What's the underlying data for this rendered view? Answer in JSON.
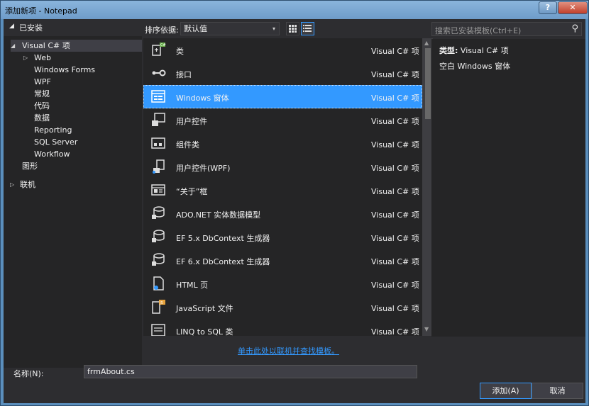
{
  "window": {
    "title": "添加新项 - Notepad",
    "help": "?",
    "close": "✕"
  },
  "left": {
    "header": "已安装",
    "tree": [
      {
        "label": "Visual C# 项",
        "selected": true
      },
      {
        "label": "Web"
      },
      {
        "label": "Windows Forms"
      },
      {
        "label": "WPF"
      },
      {
        "label": "常规"
      },
      {
        "label": "代码"
      },
      {
        "label": "数据"
      },
      {
        "label": "Reporting"
      },
      {
        "label": "SQL Server"
      },
      {
        "label": "Workflow"
      },
      {
        "label": "图形"
      },
      {
        "label": "联机"
      }
    ]
  },
  "toolbar": {
    "sort_label": "排序依据:",
    "sort_value": "默认值"
  },
  "search": {
    "placeholder": "搜索已安装模板(Ctrl+E)"
  },
  "items": [
    {
      "name": "类",
      "type": "Visual C# 项",
      "icon": "class-icon"
    },
    {
      "name": "接口",
      "type": "Visual C# 项",
      "icon": "interface-icon"
    },
    {
      "name": "Windows 窗体",
      "type": "Visual C# 项",
      "icon": "windows-form-icon"
    },
    {
      "name": "用户控件",
      "type": "Visual C# 项",
      "icon": "user-control-icon"
    },
    {
      "name": "组件类",
      "type": "Visual C# 项",
      "icon": "component-class-icon"
    },
    {
      "name": "用户控件(WPF)",
      "type": "Visual C# 项",
      "icon": "wpf-user-control-icon"
    },
    {
      "name": "“关于”框",
      "type": "Visual C# 项",
      "icon": "about-box-icon"
    },
    {
      "name": "ADO.NET 实体数据模型",
      "type": "Visual C# 项",
      "icon": "ado-net-model-icon"
    },
    {
      "name": "EF 5.x DbContext 生成器",
      "type": "Visual C# 项",
      "icon": "ef5-generator-icon"
    },
    {
      "name": "EF 6.x DbContext 生成器",
      "type": "Visual C# 项",
      "icon": "ef6-generator-icon"
    },
    {
      "name": "HTML 页",
      "type": "Visual C# 项",
      "icon": "html-page-icon"
    },
    {
      "name": "JavaScript 文件",
      "type": "Visual C# 项",
      "icon": "javascript-file-icon"
    },
    {
      "name": "LINQ to SQL 类",
      "type": "Visual C# 项",
      "icon": "linq-to-sql-icon"
    }
  ],
  "online_link": "单击此处以联机并查找模板。",
  "details": {
    "type_label": "类型:",
    "type_value": "Visual C# 项",
    "description": "空白 Windows 窗体"
  },
  "name_field": {
    "label": "名称(N):",
    "value": "frmAbout.cs"
  },
  "buttons": {
    "add": "添加(A)",
    "cancel": "取消"
  },
  "colors": {
    "accent": "#3399ff",
    "background": "#2d2d30",
    "panel": "#252526"
  }
}
